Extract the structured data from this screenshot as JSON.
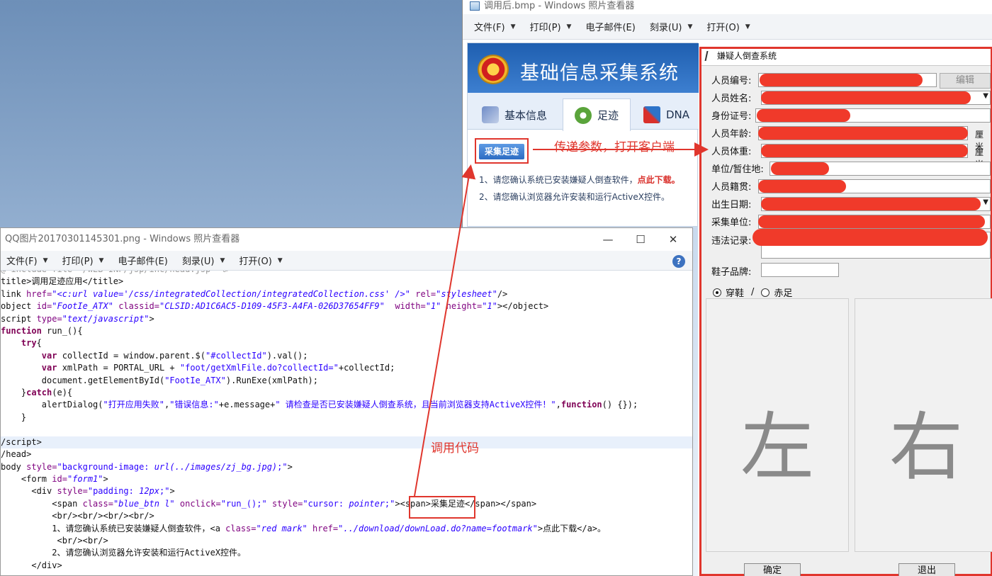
{
  "viewer_top": {
    "title": "调用后.bmp - Windows 照片查看器",
    "menu": [
      "文件(F)",
      "打印(P)",
      "电子邮件(E)",
      "刻录(U)",
      "打开(O)"
    ]
  },
  "webpage": {
    "system_title": "基础信息采集系统",
    "tabs": [
      "基本信息",
      "足迹",
      "DNA"
    ],
    "collect_button": "采集足迹",
    "note1": "1、请您确认系统已安装嫌疑人倒查软件，",
    "note1_link": "点此下载。",
    "note2": "2、请您确认浏览器允许安装和运行ActiveX控件。"
  },
  "dialog": {
    "title": "嫌疑人倒查系统",
    "fields": [
      "人员编号:",
      "人员姓名:",
      "身份证号:",
      "人员年龄:",
      "人员体重:",
      "单位/暂住地:",
      "人员籍贯:",
      "出生日期:",
      "采集单位:",
      "违法记录:",
      "鞋子品牌:"
    ],
    "edit_button": "编辑",
    "unit": "厘米",
    "radio_shoes": "穿鞋",
    "radio_sep": "/",
    "radio_barefoot": "赤足",
    "left_label": "左",
    "right_label": "右",
    "ok_button": "确定",
    "exit_button": "退出"
  },
  "viewer_code": {
    "title": "QQ图片20170301145301.png - Windows 照片查看器",
    "menu": [
      "文件(F)",
      "打印(P)",
      "电子邮件(E)",
      "刻录(U)",
      "打开(O)"
    ],
    "controls": [
      "—",
      "☐",
      "✕"
    ],
    "help": "?"
  },
  "annotations": {
    "pass_params": "传递参数，打开客户端",
    "call_code": "调用代码"
  },
  "colors": {
    "annotation_red": "#e0362d",
    "header_blue": "#2b6ec4",
    "redaction": "#f03a2a"
  }
}
